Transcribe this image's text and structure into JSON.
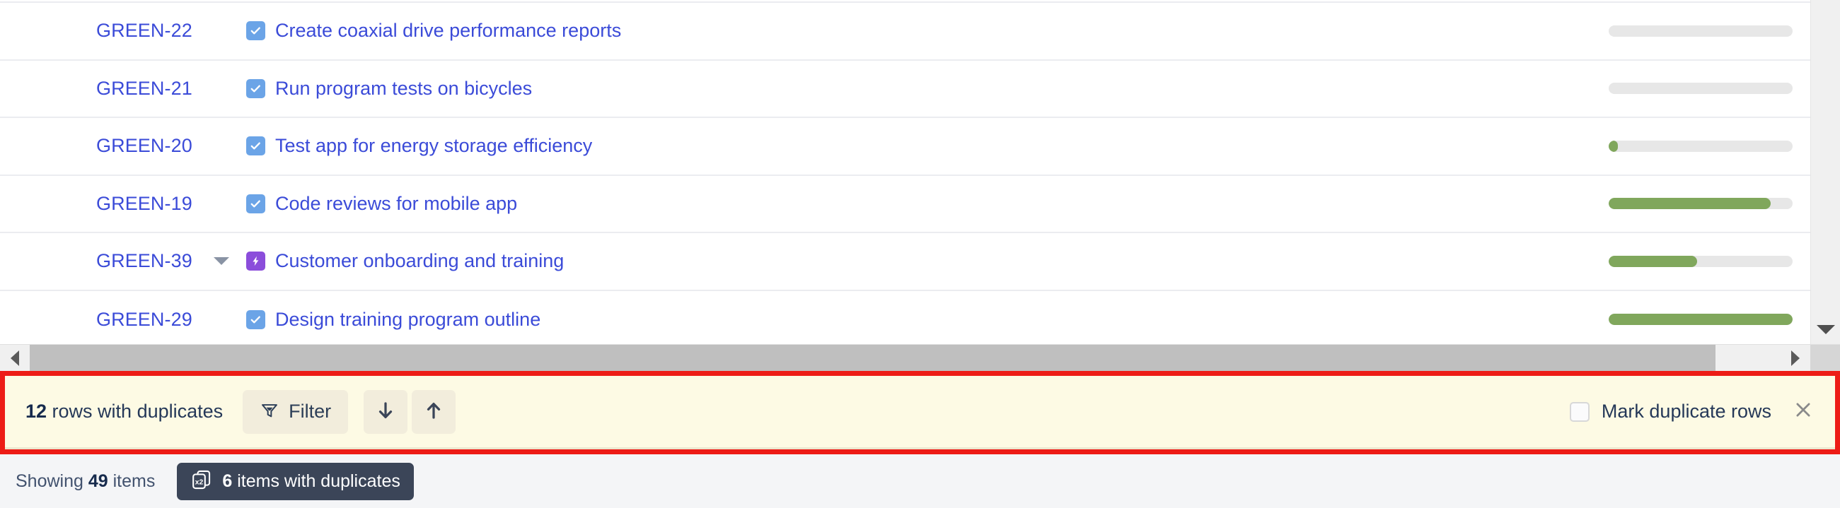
{
  "table": {
    "rows": [
      {
        "key": "GREEN-22",
        "summary": "Create coaxial drive performance reports",
        "type_icon": "subtask-checkbox-icon",
        "has_expander": false,
        "progress_percent": 0
      },
      {
        "key": "GREEN-21",
        "summary": "Run program tests on bicycles",
        "type_icon": "subtask-checkbox-icon",
        "has_expander": false,
        "progress_percent": 0
      },
      {
        "key": "GREEN-20",
        "summary": "Test app for energy storage efficiency",
        "type_icon": "subtask-checkbox-icon",
        "has_expander": false,
        "progress_percent": 5
      },
      {
        "key": "GREEN-19",
        "summary": "Code reviews for mobile app",
        "type_icon": "subtask-checkbox-icon",
        "has_expander": false,
        "progress_percent": 88
      },
      {
        "key": "GREEN-39",
        "summary": "Customer onboarding and training",
        "type_icon": "epic-bolt-icon",
        "has_expander": true,
        "progress_percent": 48
      },
      {
        "key": "GREEN-29",
        "summary": "Design training program outline",
        "type_icon": "subtask-checkbox-icon",
        "has_expander": false,
        "progress_percent": 100
      }
    ]
  },
  "duplicates_banner": {
    "count_prefix": "12",
    "count_label": " rows with duplicates",
    "filter_label": "Filter",
    "next_label": "",
    "prev_label": "",
    "mark_duplicates_label": "Mark duplicate rows",
    "mark_duplicates_checked": false,
    "close_label": "×"
  },
  "status_bar": {
    "showing_prefix": "Showing ",
    "showing_count": "49",
    "showing_suffix": " items",
    "duplicates_badge_icon": "x2",
    "duplicates_badge_count": "6",
    "duplicates_badge_label": " items with duplicates"
  },
  "colors": {
    "link_blue": "#3b4bd8",
    "subtask_blue": "#6ba4e7",
    "epic_purple": "#8b4ddb",
    "progress_green": "#80a75c",
    "progress_track": "#e7e7e7",
    "banner_bg": "#fdfae4",
    "banner_border_red": "#ed1c16",
    "badge_dark": "#3b4558"
  }
}
